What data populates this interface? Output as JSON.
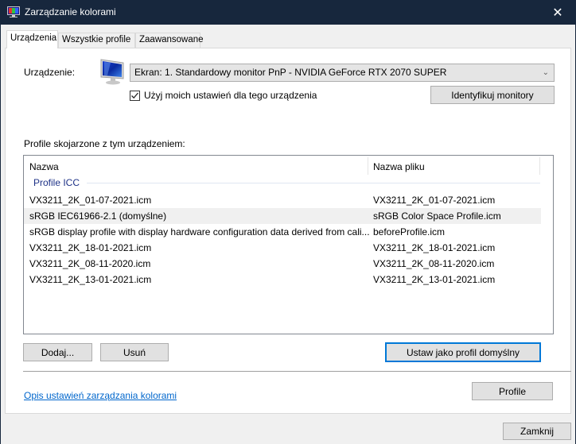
{
  "window": {
    "title": "Zarządzanie kolorami",
    "icon": "color-management-icon",
    "close_icon": "close-icon",
    "accent_color": "#17273d"
  },
  "tabs": [
    {
      "label": "Urządzenia",
      "active": true
    },
    {
      "label": "Wszystkie profile",
      "active": false
    },
    {
      "label": "Zaawansowane",
      "active": false
    }
  ],
  "device": {
    "label": "Urządzenie:",
    "icon": "monitor-icon",
    "selected": "Ekran: 1. Standardowy monitor PnP - NVIDIA GeForce RTX 2070 SUPER",
    "use_my_settings_label": "Użyj moich ustawień dla tego urządzenia",
    "use_my_settings_checked": true,
    "identify_button": "Identyfikuj monitory"
  },
  "profiles": {
    "label": "Profile skojarzone z tym urządzeniem:",
    "columns": [
      "Nazwa",
      "Nazwa pliku"
    ],
    "group": "Profile ICC",
    "rows": [
      {
        "name": "VX3211_2K_01-07-2021.icm",
        "file": "VX3211_2K_01-07-2021.icm",
        "selected": false
      },
      {
        "name": "sRGB IEC61966-2.1 (domyślne)",
        "file": "sRGB Color Space Profile.icm",
        "selected": true
      },
      {
        "name": "sRGB display profile with display hardware configuration data derived from cali...",
        "file": "beforeProfile.icm",
        "selected": false
      },
      {
        "name": "VX3211_2K_18-01-2021.icm",
        "file": "VX3211_2K_18-01-2021.icm",
        "selected": false
      },
      {
        "name": "VX3211_2K_08-11-2020.icm",
        "file": "VX3211_2K_08-11-2020.icm",
        "selected": false
      },
      {
        "name": "VX3211_2K_13-01-2021.icm",
        "file": "VX3211_2K_13-01-2021.icm",
        "selected": false
      }
    ]
  },
  "buttons": {
    "add": "Dodaj...",
    "remove": "Usuń",
    "set_default": "Ustaw jako profil domyślny",
    "profile": "Profile",
    "close": "Zamknij"
  },
  "link": "Opis ustawień zarządzania kolorami",
  "chevron_icon": "chevron-down-icon",
  "checkmark_icon": "checkmark-icon"
}
